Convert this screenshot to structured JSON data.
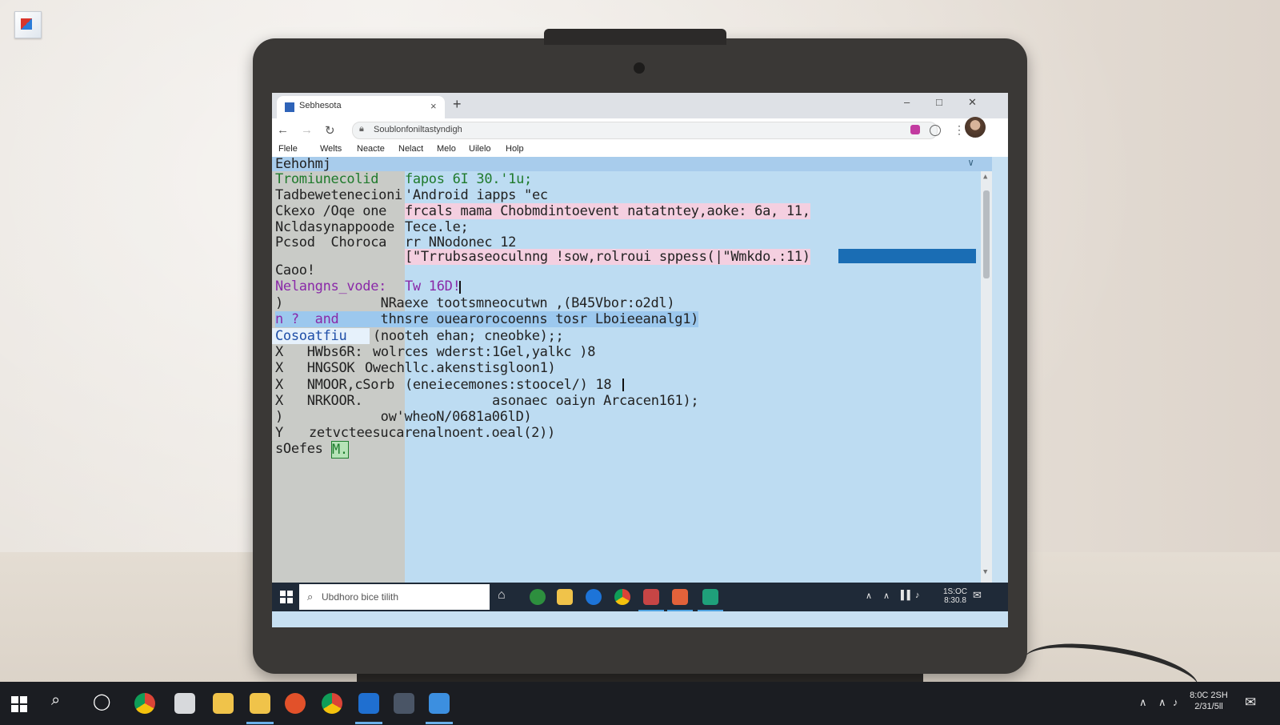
{
  "browser": {
    "tab_title": "Sebhesota",
    "close_glyph": "×",
    "newtab_glyph": "+",
    "address": "Soublonfoniltastyndigh",
    "menu": [
      "Flele",
      "Welts",
      "Neacte",
      "Nelact",
      "Melo",
      "Uilelo",
      "Holp"
    ]
  },
  "editor": {
    "header": "Eehohmj",
    "lines": [
      "Tromiunecolid",
      "Tadbewetenecioni",
      "Ckexo /Oqe one",
      "Ncldasynappoode",
      "Pcsod  Choroca",
      "",
      "Caoo!",
      "Nelangns_vode:",
      ")",
      "n ?  and'c)",
      "Cosoatfiu",
      "X   HWbs6R:",
      "X   HNGSOK",
      "X   NMOOR,cSorb",
      "X   NRKOOR.",
      ")",
      "Y",
      "sOefes"
    ],
    "code": [
      "fapos 6I 30.'1u;",
      "'Android iapps \"ec",
      "frcals mama Chobmdintoevent natatntey,aoke: 6a, 11,",
      "Tece.le;",
      "rr NNodonec 12",
      "[\"Trrubsaseoculnng !sow,rolroui sppess(|\"Wmkdo.:11)",
      "",
      "Tw 16D!",
      "     NRaexe tootsmneocutwn ,(B45Vbor:o2dl)",
      "     thnsre ouearorocoenns tosr Lboieeanalg1)",
      "(nooteh ehan; cneobke);;",
      "wolrces wderst:1Gel,yalkc )8",
      "Owechllc.akenstisgloon1)",
      "(eneiecemones:stoocel/) 18",
      "               asonaec oaiyn Arcacen161);",
      "     ow'wheoN/0681a06lD)",
      "zetvcteesucarenalnoent.oeal(2))",
      "M."
    ]
  },
  "inner_taskbar": {
    "search_placeholder": "Ubdhoro bice tilith",
    "clock_time": "1S:OC",
    "clock_date": "8:30.8"
  },
  "outer_taskbar": {
    "clock_time": "8:0C 2SH",
    "clock_date": "2/31/5ll"
  },
  "colors": {
    "code_bg": "#bddcf2",
    "selection": "#1a6db4",
    "taskbar": "#1b1d22"
  }
}
